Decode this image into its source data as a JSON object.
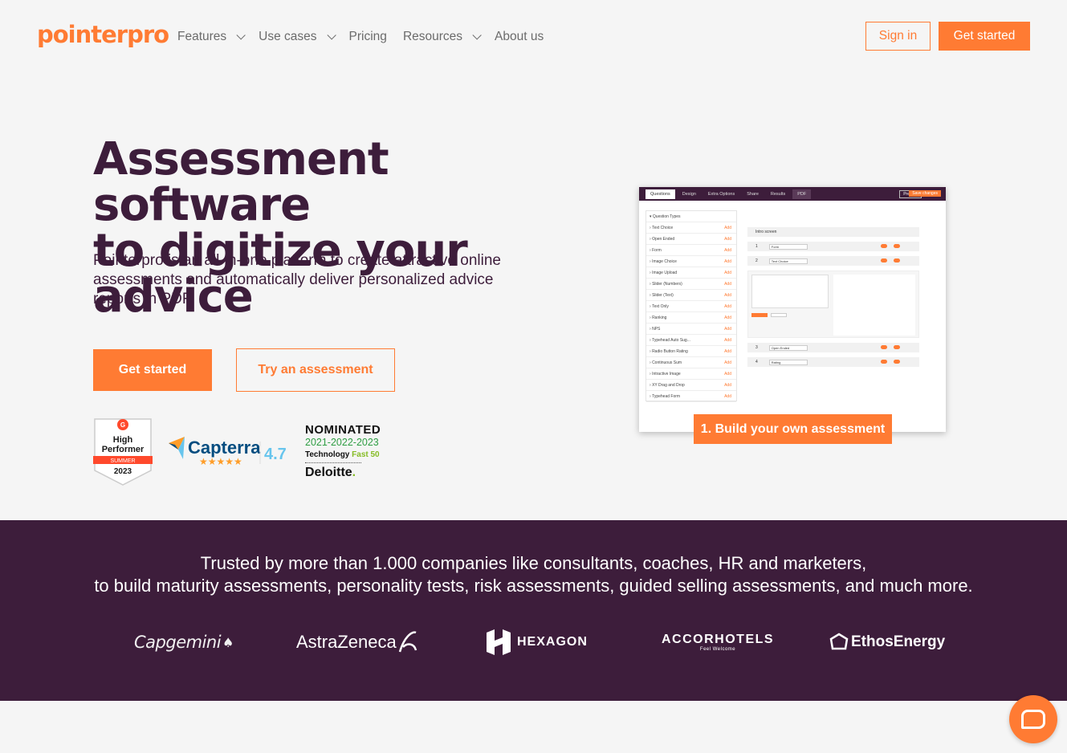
{
  "header": {
    "logo": "pointerpro",
    "nav": [
      {
        "label": "Features",
        "dropdown": true
      },
      {
        "label": "Use cases",
        "dropdown": true
      },
      {
        "label": "Pricing",
        "dropdown": false
      },
      {
        "label": "Resources",
        "dropdown": true
      },
      {
        "label": "About us",
        "dropdown": false
      }
    ],
    "sign_in": "Sign in",
    "get_started": "Get started"
  },
  "hero": {
    "title_line1": "Assessment software",
    "title_line2": "to digitize your advice",
    "subtitle": "Pointerpro is an all-in-one platform to create attractive online assessments and automatically deliver personalized advice reports in PDF.",
    "cta_primary": "Get started",
    "cta_secondary": "Try an assessment"
  },
  "badges": {
    "g2": {
      "line1": "High",
      "line2": "Performer",
      "season": "SUMMER",
      "year": "2023"
    },
    "capterra": {
      "name": "Capterra",
      "rating": "4.7"
    },
    "deloitte": {
      "nominated": "NOMINATED",
      "years": "2021-2022-2023",
      "tech": "Technology",
      "fast": "Fast 50",
      "name": "Deloitte",
      "dot": "."
    }
  },
  "mock": {
    "tabs": [
      "Questions",
      "Design",
      "Extra Options",
      "Share",
      "Results",
      "PDF"
    ],
    "preview": "Preview",
    "save": "Save changes",
    "list_header": "Question Types",
    "add_label": "Add",
    "question_types": [
      "Text Choice",
      "Open Ended",
      "Form",
      "Image Choice",
      "Image Upload",
      "Slider (Numbers)",
      "Slider (Text)",
      "Text Only",
      "Ranking",
      "NPS",
      "Typehead Auto Sug...",
      "Radio Button Rating",
      "Continuous Sum",
      "Intractive Image",
      "XY Drag and Drop",
      "Typehead Form"
    ],
    "intro": "Intro screen",
    "rows": [
      {
        "num": "1",
        "type": "Form"
      },
      {
        "num": "2",
        "type": "Text Choice"
      },
      {
        "num": "3",
        "type": "Open Ended"
      },
      {
        "num": "4",
        "type": "Rating"
      }
    ],
    "caption": "1. Build your own assessment"
  },
  "trusted": {
    "line1": "Trusted by more than 1.000 companies like consultants, coaches, HR and marketers,",
    "line2": "to build maturity assessments, personality tests, risk assessments, guided selling assessments, and much more.",
    "logos": {
      "capgemini": "Capgemini",
      "astrazeneca": "AstraZeneca",
      "hexagon": "HEXAGON",
      "accor": "ACCORHOTELS",
      "accor_tag": "Feel Welcome",
      "ethos": "EthosEnergy"
    }
  },
  "colors": {
    "accent": "#ff7b33",
    "brand_dark": "#3d1d3b",
    "background": "#f5f5f5"
  }
}
